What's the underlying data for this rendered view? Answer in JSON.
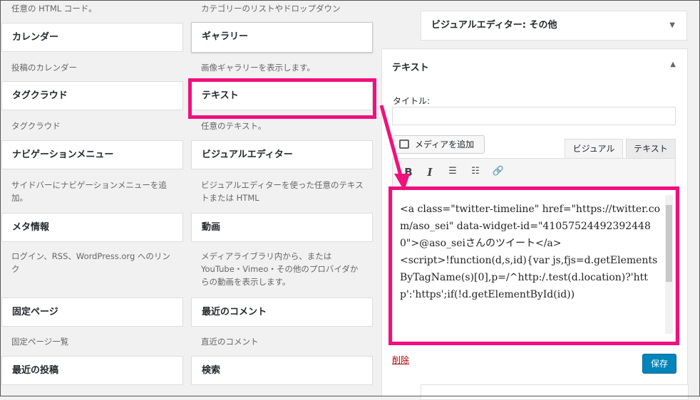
{
  "left_col": [
    {
      "desc": "任意の HTML コード。",
      "title": ""
    },
    {
      "title": "カレンダー",
      "desc": "投稿のカレンダー"
    },
    {
      "title": "タグクラウド",
      "desc": "タグクラウド"
    },
    {
      "title": "ナビゲーションメニュー",
      "desc": "サイドバーにナビゲーションメニューを追加。"
    },
    {
      "title": "メタ情報",
      "desc": "ログイン、RSS、WordPress.org へのリンク"
    },
    {
      "title": "固定ページ",
      "desc": "固定ページ一覧"
    },
    {
      "title": "最近の投稿",
      "desc": ""
    }
  ],
  "mid_col": [
    {
      "desc": "カテゴリーのリストやドロップダウン",
      "title": ""
    },
    {
      "title": "ギャラリー",
      "desc": "画像ギャラリーを表示します。"
    },
    {
      "title": "テキスト",
      "desc": "任意のテキスト。"
    },
    {
      "title": "ビジュアルエディター",
      "desc": "ビジュアルエディターを使った任意のテキストまたは HTML"
    },
    {
      "title": "動画",
      "desc": "メディアライブラリ内から、または YouTube・Vimeo・その他のプロバイダからの動画を表示します。"
    },
    {
      "title": "最近のコメント",
      "desc": "直近のコメント"
    },
    {
      "title": "検索",
      "desc": ""
    }
  ],
  "right": {
    "visual_widget_title": "ビジュアルエディター: その他",
    "panel_title": "テキスト",
    "title_label": "タイトル:",
    "title_value": "",
    "media_button": "メディアを追加",
    "tab_visual": "ビジュアル",
    "tab_text": "テキスト",
    "editor_content": "<a class=\"twitter-timeline\" href=\"https://twitter.com/aso_sei\" data-widget-id=\"410575244923924480\">@aso_seiさんのツイート</a>\n<script>!function(d,s,id){var js,fjs=d.getElementsByTagName(s)[0],p=/^http:/.test(d.location)?'http':'https';if(!d.getElementById(id))",
    "delete_link": "削除",
    "save_button": "保存"
  },
  "icons": {
    "collapse_down": "▼",
    "collapse_up": "▲",
    "italic": "I",
    "bullet_list": "☰",
    "number_list": "☷",
    "link": "🔗"
  },
  "colors": {
    "highlight": "#f0107e",
    "primary": "#0085ba",
    "delete": "#a00000"
  }
}
